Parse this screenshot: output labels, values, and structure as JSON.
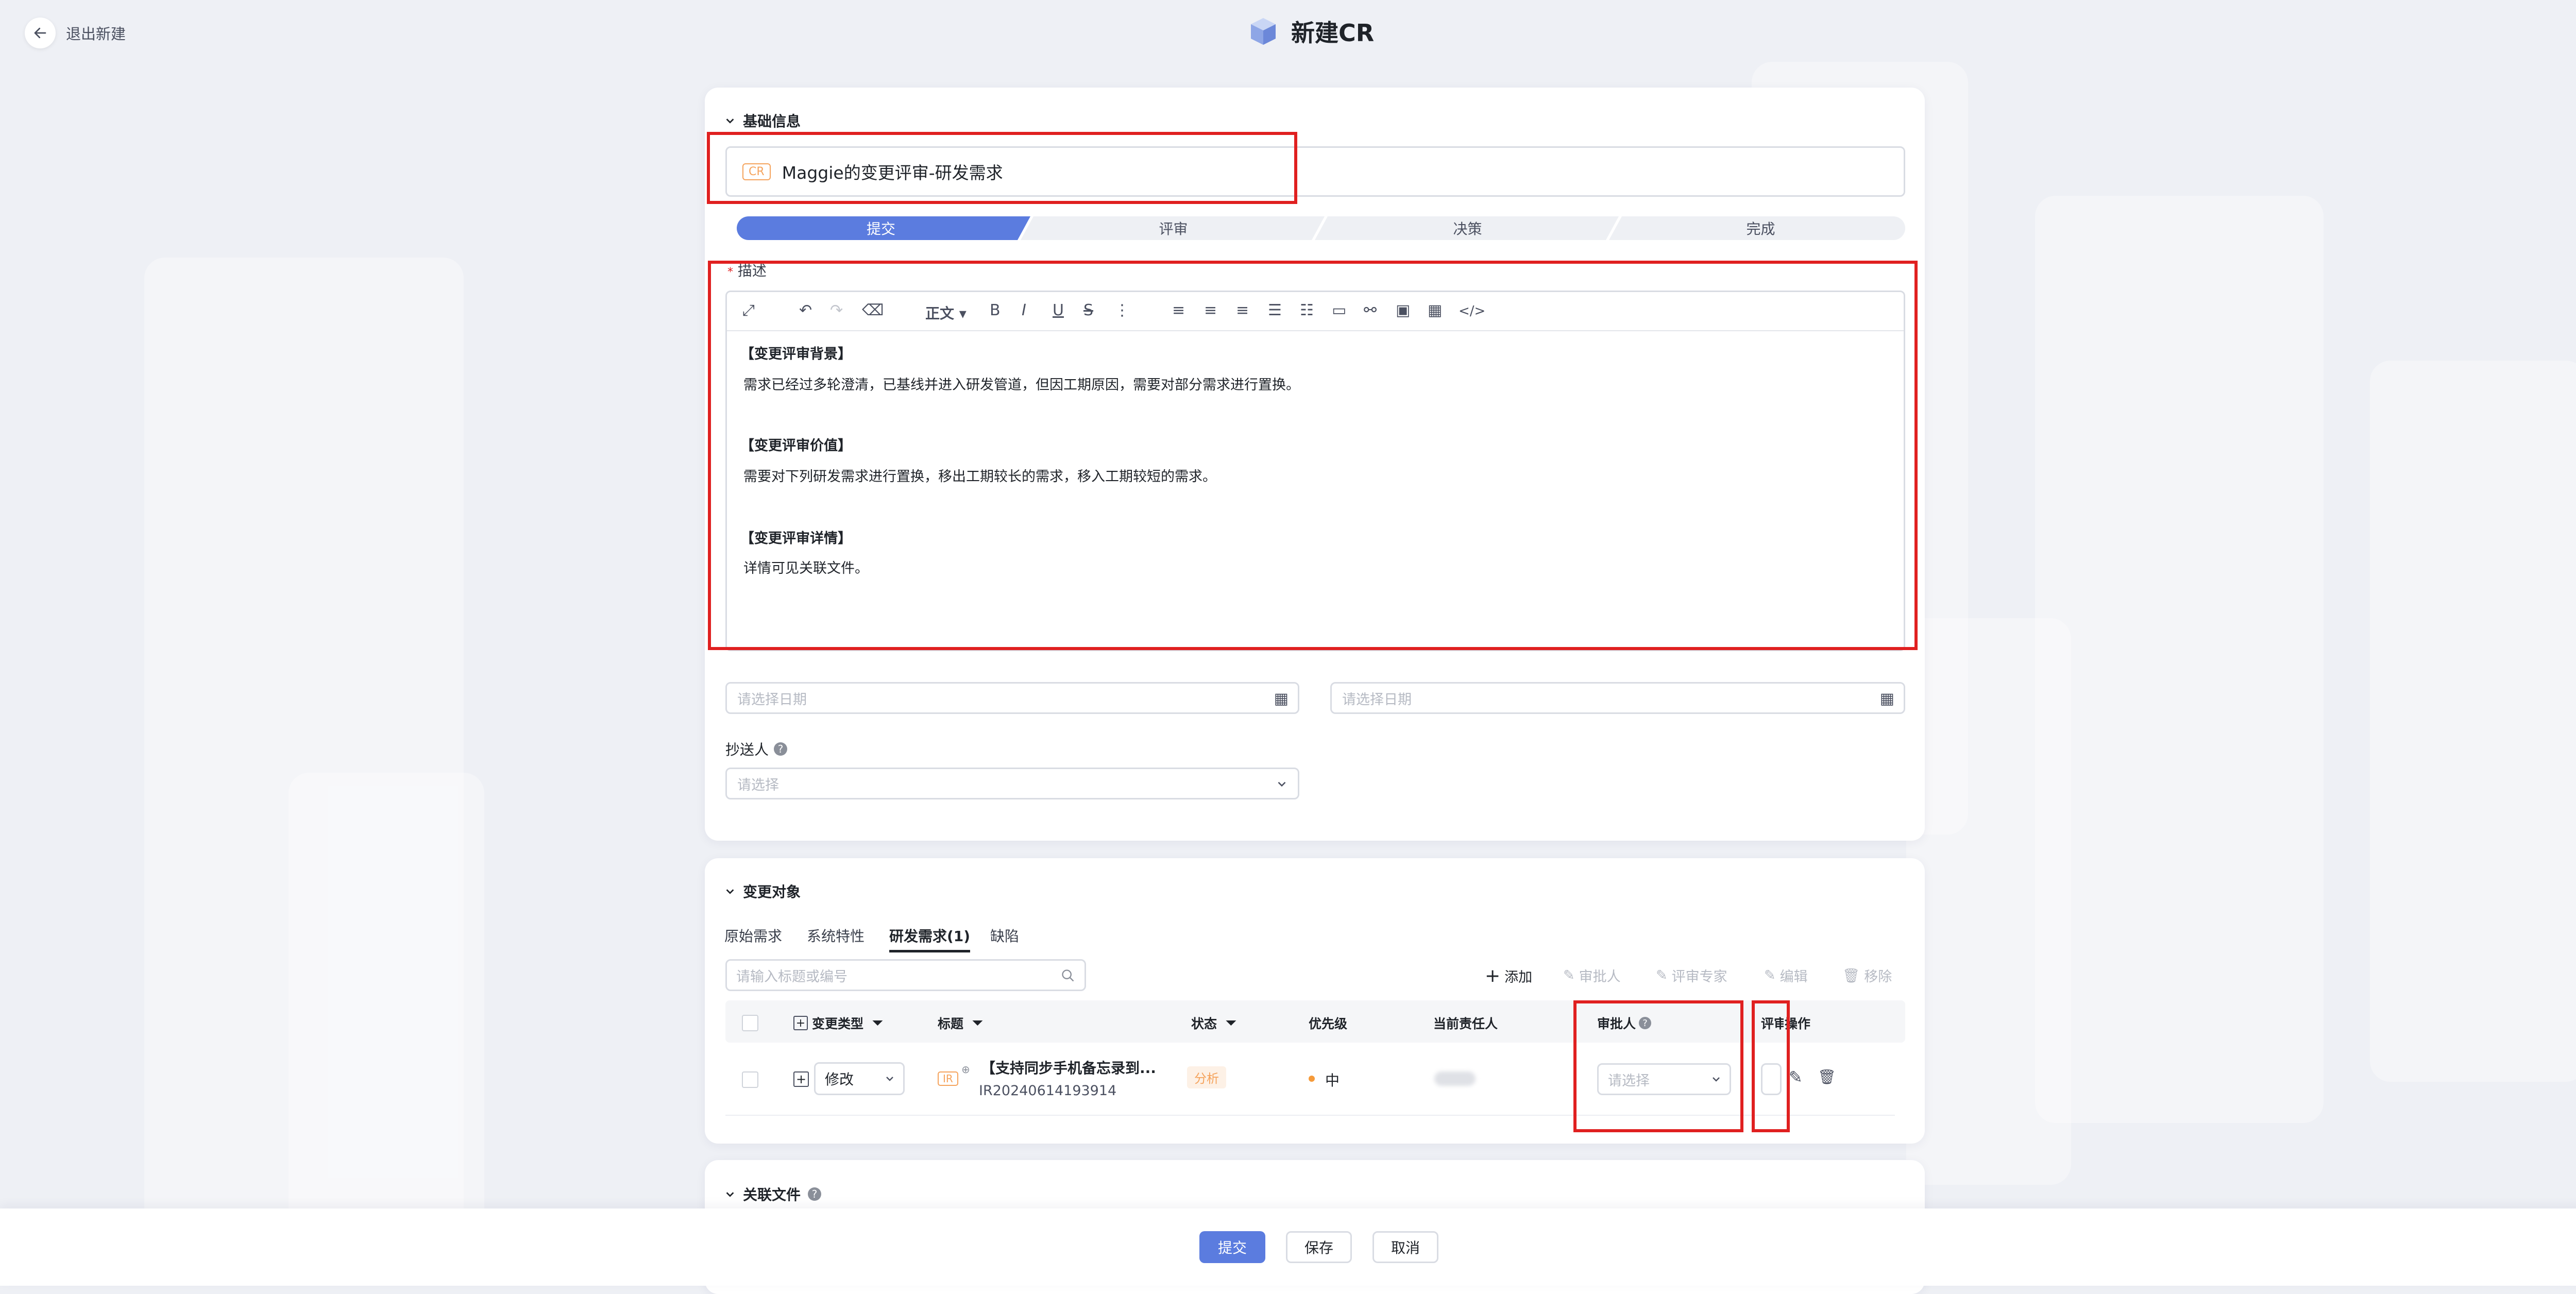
{
  "header": {
    "back_label": "退出新建",
    "title": "新建CR"
  },
  "basic": {
    "section_title": "基础信息",
    "cr_badge": "CR",
    "title_value": "Maggie的变更评审-研发需求",
    "steps": [
      "提交",
      "评审",
      "决策",
      "完成"
    ],
    "active_step": 0,
    "desc_label": "描述",
    "toolbar": {
      "paragraph": "正文",
      "bold": "B",
      "italic": "I",
      "underline": "U",
      "strike": "S"
    },
    "desc": {
      "h1": "【变更评审背景】",
      "p1": "需求已经过多轮澄清，已基线并进入研发管道，但因工期原因，需要对部分需求进行置换。",
      "h2": "【变更评审价值】",
      "p2": "需要对下列研发需求进行置换，移出工期较长的需求，移入工期较短的需求。",
      "h3": "【变更评审详情】",
      "p3": "详情可见关联文件。"
    },
    "date_placeholder": "请选择日期",
    "cc_label": "抄送人",
    "cc_placeholder": "请选择"
  },
  "change": {
    "section_title": "变更对象",
    "tabs": [
      "原始需求",
      "系统特性",
      "研发需求(1)",
      "缺陷"
    ],
    "active_tab": 2,
    "search_placeholder": "请输入标题或编号",
    "actions": {
      "add": "添加",
      "approver": "审批人",
      "expert": "评审专家",
      "edit": "编辑",
      "remove": "移除"
    },
    "columns": {
      "type": "变更类型",
      "title": "标题",
      "status": "状态",
      "priority": "优先级",
      "owner": "当前责任人",
      "approver": "审批人",
      "reviewer": "评审",
      "operation": "操作"
    },
    "row": {
      "type": "修改",
      "ir_badge": "IR",
      "title": "【支持同步手机备忘录到...",
      "code": "IR20240614193914",
      "status": "分析",
      "priority": "中",
      "approver_placeholder": "请选择"
    }
  },
  "files": {
    "section_title": "关联文件"
  },
  "footer": {
    "submit": "提交",
    "save": "保存",
    "cancel": "取消"
  },
  "colors": {
    "primary": "#5b7cdf",
    "highlight": "#e02020",
    "status_orange": "#f5a35c",
    "priority_dot": "#f59a3a"
  }
}
